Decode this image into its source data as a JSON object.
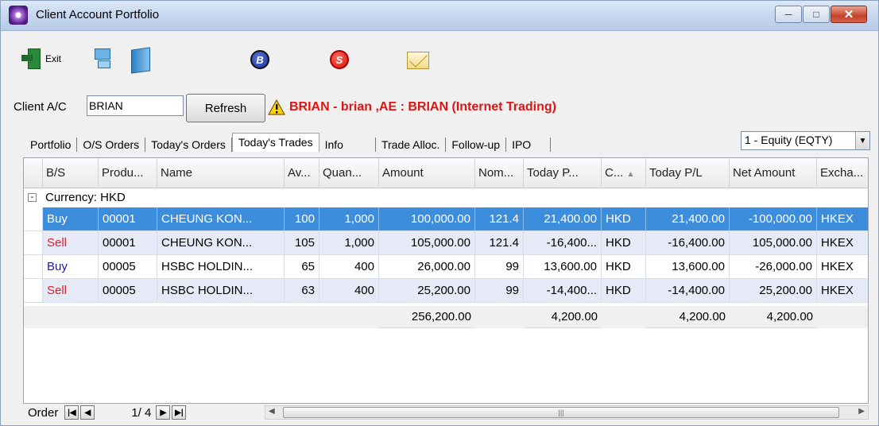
{
  "window": {
    "title": "Client Account Portfolio",
    "controls": [
      "minimize",
      "maximize",
      "close"
    ]
  },
  "toolbar": {
    "exit_label": "Exit",
    "icons": [
      "exit-icon",
      "network-icon",
      "book-icon",
      "buy-icon",
      "sell-icon",
      "mail-icon"
    ],
    "buy_icon_glyph": "B",
    "sell_icon_glyph": "S"
  },
  "client": {
    "label": "Client A/C",
    "value": "BRIAN",
    "refresh_label": "Refresh",
    "status_text": "BRIAN - brian ,AE : BRIAN (Internet Trading)"
  },
  "tabs": [
    "Portfolio",
    "O/S Orders",
    "Today's Orders",
    "Today's Trades",
    "Info",
    "Trade Alloc.",
    "Follow-up",
    "IPO"
  ],
  "active_tab": "Today's Trades",
  "market_select": {
    "selected": "1 - Equity (EQTY)"
  },
  "grid": {
    "columns": [
      "B/S",
      "Produ...",
      "Name",
      "Av...",
      "Quan...",
      "Amount",
      "Nom...",
      "Today P...",
      "C...",
      "Today P/L",
      "Net Amount",
      "Excha..."
    ],
    "group_label": "Currency: HKD",
    "rows": [
      {
        "bs": "Buy",
        "product": "00001",
        "name": "CHEUNG KON...",
        "avg": "100",
        "qty": "1,000",
        "amount": "100,000.00",
        "nominal": "121.4",
        "today_p": "21,400.00",
        "ccy": "HKD",
        "today_pl": "21,400.00",
        "net_amount": "-100,000.00",
        "exchange": "HKEX",
        "selected": true
      },
      {
        "bs": "Sell",
        "product": "00001",
        "name": "CHEUNG KON...",
        "avg": "105",
        "qty": "1,000",
        "amount": "105,000.00",
        "nominal": "121.4",
        "today_p": "-16,400...",
        "ccy": "HKD",
        "today_pl": "-16,400.00",
        "net_amount": "105,000.00",
        "exchange": "HKEX",
        "selected": false
      },
      {
        "bs": "Buy",
        "product": "00005",
        "name": "HSBC HOLDIN...",
        "avg": "65",
        "qty": "400",
        "amount": "26,000.00",
        "nominal": "99",
        "today_p": "13,600.00",
        "ccy": "HKD",
        "today_pl": "13,600.00",
        "net_amount": "-26,000.00",
        "exchange": "HKEX",
        "selected": false
      },
      {
        "bs": "Sell",
        "product": "00005",
        "name": "HSBC HOLDIN...",
        "avg": "63",
        "qty": "400",
        "amount": "25,200.00",
        "nominal": "99",
        "today_p": "-14,400...",
        "ccy": "HKD",
        "today_pl": "-14,400.00",
        "net_amount": "25,200.00",
        "exchange": "HKEX",
        "selected": false
      }
    ],
    "totals": {
      "amount": "256,200.00",
      "today_p": "4,200.00",
      "today_pl": "4,200.00",
      "net_amount": "4,200.00"
    }
  },
  "pager": {
    "label": "Order",
    "page_text": "1/ 4"
  },
  "colors": {
    "selection": "#3c8edd",
    "buy": "#1a1a9e",
    "sell": "#d8202e",
    "status_red": "#e01414"
  }
}
